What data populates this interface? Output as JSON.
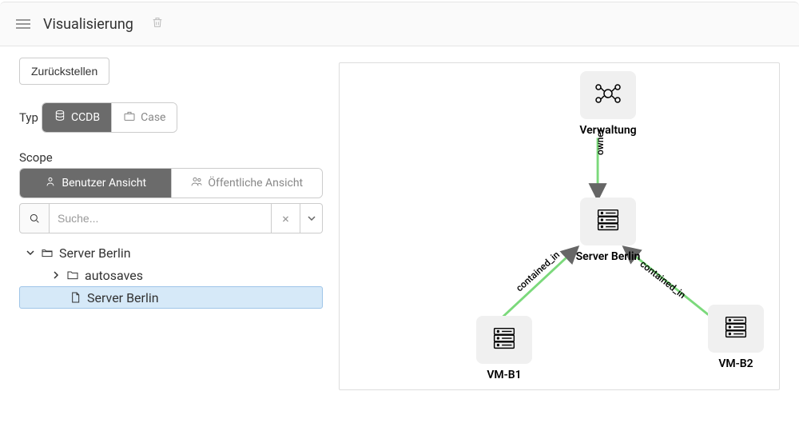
{
  "header": {
    "title": "Visualisierung"
  },
  "buttons": {
    "reset_label": "Zurückstellen"
  },
  "type_filter": {
    "label": "Typ",
    "options": [
      {
        "label": "CCDB",
        "active": true
      },
      {
        "label": "Case",
        "active": false
      }
    ]
  },
  "scope": {
    "label": "Scope",
    "options": [
      {
        "label": "Benutzer Ansicht",
        "active": true
      },
      {
        "label": "Öffentliche Ansicht",
        "active": false
      }
    ]
  },
  "search": {
    "placeholder": "Suche..."
  },
  "tree": {
    "root": {
      "label": "Server Berlin",
      "expanded": true
    },
    "child1": {
      "label": "autosaves",
      "expanded": false
    },
    "child2": {
      "label": "Server Berlin",
      "selected": true
    }
  },
  "graph": {
    "nodes": [
      {
        "id": "verwaltung",
        "label": "Verwaltung",
        "type": "group"
      },
      {
        "id": "server_berlin",
        "label": "Server Berlin",
        "type": "server"
      },
      {
        "id": "vm_b1",
        "label": "VM-B1",
        "type": "server"
      },
      {
        "id": "vm_b2",
        "label": "VM-B2",
        "type": "server"
      }
    ],
    "edges": [
      {
        "from": "verwaltung",
        "to": "server_berlin",
        "label": "owner"
      },
      {
        "from": "vm_b1",
        "to": "server_berlin",
        "label": "contained_in"
      },
      {
        "from": "vm_b2",
        "to": "server_berlin",
        "label": "contained_in"
      }
    ]
  }
}
